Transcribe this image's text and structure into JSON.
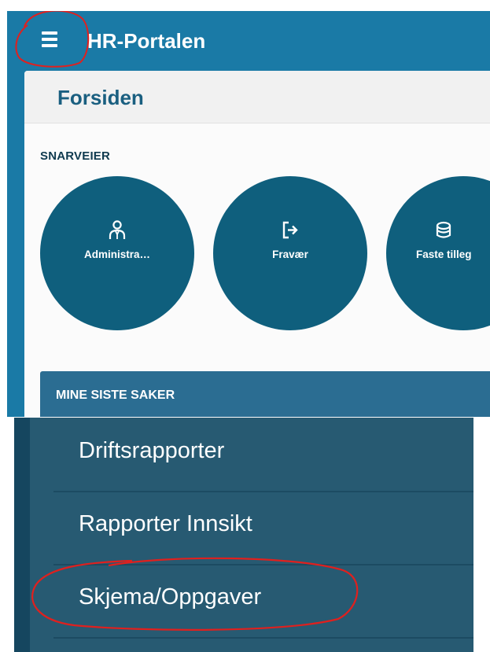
{
  "header": {
    "app_title": "HR-Portalen",
    "menu_icon": "hamburger-menu-icon"
  },
  "page": {
    "title": "Forsiden"
  },
  "shortcuts": {
    "section_label": "SNARVEIER",
    "items": [
      {
        "label": "Administra…",
        "icon": "person-admin-icon"
      },
      {
        "label": "Fravær",
        "icon": "exit-door-icon"
      },
      {
        "label": "Faste tilleg",
        "icon": "coin-stack-icon"
      }
    ]
  },
  "recent_cases": {
    "label": "MINE SISTE SAKER"
  },
  "side_menu": {
    "items": [
      {
        "label": "Driftsrapporter"
      },
      {
        "label": "Rapporter Innsikt"
      },
      {
        "label": "Skjema/Oppgaver"
      }
    ]
  },
  "colors": {
    "app_bar": "#1a7aa6",
    "shortcut_circle": "#0f5f7d",
    "recent_bar": "#2b6d92",
    "side_menu_bg": "#275a72",
    "annotation": "#e0201e"
  }
}
